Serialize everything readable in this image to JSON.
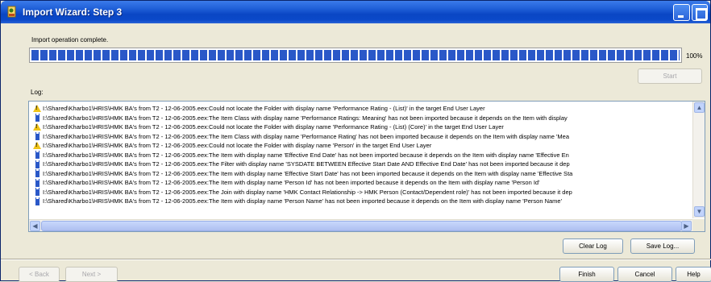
{
  "window": {
    "title": "Import Wizard: Step 3",
    "controls": [
      "minimize-icon",
      "maximize-icon"
    ]
  },
  "status": {
    "message": "Import operation complete.",
    "progress_percent": 100,
    "progress_label": "100%"
  },
  "buttons": {
    "start": "Start",
    "clear_log": "Clear Log",
    "save_log": "Save Log...",
    "back": "< Back",
    "next": "Next >",
    "finish": "Finish",
    "cancel": "Cancel",
    "help": "Help"
  },
  "log": {
    "label": "Log:",
    "lines": [
      {
        "icon": "warning-icon",
        "text": "I:\\Shared\\Kharbo1\\HRIS\\HMK BA's from T2 - 12-06-2005.eex:Could not locate the Folder with display name 'Performance Rating - (List)' in the target End User Layer"
      },
      {
        "icon": "info-icon",
        "text": "I:\\Shared\\Kharbo1\\HRIS\\HMK BA's from T2 - 12-06-2005.eex:The Item Class with display name 'Performance Ratings: Meaning' has not been imported because it depends on the Item with display"
      },
      {
        "icon": "warning-icon",
        "text": "I:\\Shared\\Kharbo1\\HRIS\\HMK BA's from T2 - 12-06-2005.eex:Could not locate the Folder with display name 'Performance Rating - (List) (Core)' in the target End User Layer"
      },
      {
        "icon": "info-icon",
        "text": "I:\\Shared\\Kharbo1\\HRIS\\HMK BA's from T2 - 12-06-2005.eex:The Item Class with display name 'Performance Rating' has not been imported because it depends on the Item with display name 'Mea"
      },
      {
        "icon": "warning-icon",
        "text": "I:\\Shared\\Kharbo1\\HRIS\\HMK BA's from T2 - 12-06-2005.eex:Could not locate the Folder with display name 'Person' in the target End User Layer"
      },
      {
        "icon": "info-icon",
        "text": "I:\\Shared\\Kharbo1\\HRIS\\HMK BA's from T2 - 12-06-2005.eex:The Item with display name 'Effective End Date' has not been imported because it depends on the Item with display name 'Effective En"
      },
      {
        "icon": "info-icon",
        "text": "I:\\Shared\\Kharbo1\\HRIS\\HMK BA's from T2 - 12-06-2005.eex:The Filter with display name 'SYSDATE BETWEEN Effective Start Date AND Effective End Date' has not been imported because it dep"
      },
      {
        "icon": "info-icon",
        "text": "I:\\Shared\\Kharbo1\\HRIS\\HMK BA's from T2 - 12-06-2005.eex:The Item with display name 'Effective Start Date' has not been imported because it depends on the Item with display name 'Effective Sta"
      },
      {
        "icon": "info-icon",
        "text": "I:\\Shared\\Kharbo1\\HRIS\\HMK BA's from T2 - 12-06-2005.eex:The Item with display name 'Person Id' has not been imported because it depends on the Item with display name 'Person Id'"
      },
      {
        "icon": "info-icon",
        "text": "I:\\Shared\\Kharbo1\\HRIS\\HMK BA's from T2 - 12-06-2005.eex:The Join with display name 'HMK Contact Relationship -> HMK Person (Contact/Dependent role)' has not been imported because it dep"
      },
      {
        "icon": "info-icon",
        "text": "I:\\Shared\\Kharbo1\\HRIS\\HMK BA's from T2 - 12-06-2005.eex:The Item with display name 'Person Name' has not been imported because it depends on the Item with display name 'Person Name'"
      }
    ]
  }
}
